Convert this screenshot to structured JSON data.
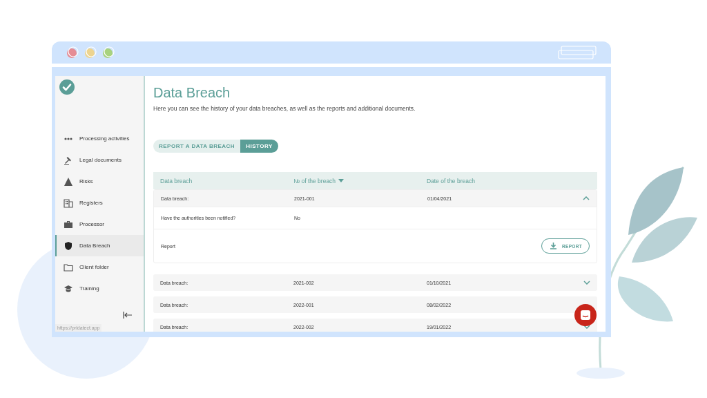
{
  "sidebar": {
    "items": [
      {
        "label": "Processing activities",
        "selected": false
      },
      {
        "label": "Legal documents",
        "selected": false
      },
      {
        "label": "Risks",
        "selected": false
      },
      {
        "label": "Registers",
        "selected": false
      },
      {
        "label": "Processor",
        "selected": false
      },
      {
        "label": "Data Breach",
        "selected": true
      },
      {
        "label": "Client folder",
        "selected": false
      },
      {
        "label": "Training",
        "selected": false
      }
    ]
  },
  "status_url": "https://pridatect.app",
  "page": {
    "title": "Data Breach",
    "subtitle": "Here you can see the history of your data breaches, as well as the reports and additional documents."
  },
  "tabs": [
    {
      "label": "REPORT A DATA BREACH",
      "selected": false
    },
    {
      "label": "HISTORY",
      "selected": true
    }
  ],
  "table": {
    "columns": [
      {
        "label": "Data breach",
        "sorted": false
      },
      {
        "label": "№ of the breach",
        "sorted": true
      },
      {
        "label": "Date of the breach",
        "sorted": false
      }
    ],
    "rows": [
      {
        "label": "Data breach:",
        "number": "2021-001",
        "date": "01/04/2021",
        "expanded": true,
        "details": [
          {
            "label": "Have the authorities been notified?",
            "value": "No"
          },
          {
            "label": "Report",
            "button": "REPORT"
          }
        ]
      },
      {
        "label": "Data breach:",
        "number": "2021-002",
        "date": "01/10/2021",
        "expanded": false
      },
      {
        "label": "Data breach:",
        "number": "2022-001",
        "date": "08/02/2022"
      },
      {
        "label": "Data breach:",
        "number": "2022-002",
        "date": "19/01/2022",
        "expanded": false
      }
    ]
  }
}
